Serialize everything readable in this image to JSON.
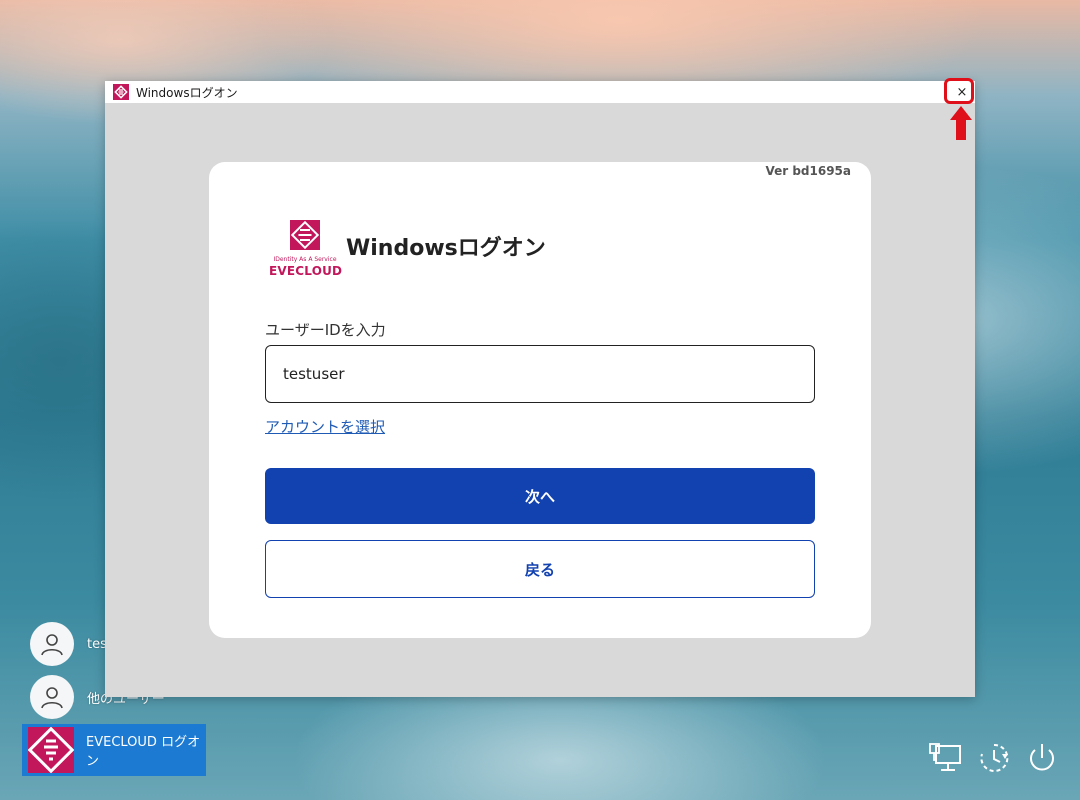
{
  "lock_screen": {
    "users": [
      {
        "name": "tes"
      },
      {
        "name": "他のユーザー"
      }
    ],
    "evecloud_tile_label": "EVECLOUD ログオン"
  },
  "window": {
    "title": "Windowsログオン",
    "close_glyph": "×",
    "version": "Ver bd1695a",
    "brand": {
      "tagline": "IDentity As A Service",
      "name": "EVECLOUD"
    },
    "heading": "Windowsログオン",
    "field_label": "ユーザーIDを入力",
    "user_id_value": "testuser",
    "select_account_link": "アカウントを選択",
    "next_button": "次へ",
    "back_button": "戻る"
  },
  "colors": {
    "brand_magenta": "#c2185b",
    "primary_blue": "#1241b0",
    "link_blue": "#1f5bb5",
    "tile_blue": "#1c7ad2",
    "highlight_red": "#e0101a"
  },
  "icons": [
    "evecloud-logo-icon",
    "close-icon",
    "red-arrow-up-icon",
    "user-avatar-icon",
    "network-icon",
    "accessibility-icon",
    "power-icon"
  ]
}
